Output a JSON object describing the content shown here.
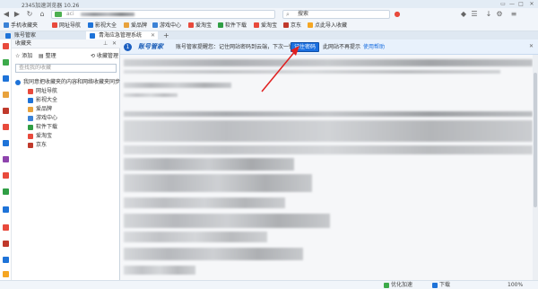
{
  "window": {
    "title": "2345加速浏览器 10.26",
    "controls": [
      "▭",
      "—",
      "□",
      "✕"
    ]
  },
  "nav": {
    "back": "◀",
    "forward": "▶",
    "refresh": "↻",
    "home": "⌂",
    "address_value": "aci",
    "search_placeholder": "搜索"
  },
  "bookmarks_bar": {
    "items": [
      {
        "label": "手机收藏夹",
        "color": "#3b82d6"
      },
      {
        "label": "网址导航",
        "color": "#e84a3c"
      },
      {
        "label": "影视大全",
        "color": "#1e73d8"
      },
      {
        "label": "爱品牌",
        "color": "#e8a23c"
      },
      {
        "label": "游戏中心",
        "color": "#3b82d6"
      },
      {
        "label": "爱淘宝",
        "color": "#e84a3c"
      },
      {
        "label": "软件下载",
        "color": "#2f9e44"
      },
      {
        "label": "爱淘宝",
        "color": "#e84a3c"
      },
      {
        "label": "京东",
        "color": "#c0392b"
      },
      {
        "label": "点此导入收藏",
        "color": "#f5a623"
      }
    ]
  },
  "tabs": [
    {
      "label": "账号管家",
      "active": false
    },
    {
      "label": "青海应急管理系统",
      "active": true
    }
  ],
  "new_tab": "+",
  "rail_icons": [
    {
      "name": "news-icon",
      "color": "#e84a3c"
    },
    {
      "name": "game-icon",
      "color": "#3caa4a"
    },
    {
      "name": "video-icon",
      "color": "#1e73d8"
    },
    {
      "name": "mail-icon",
      "color": "#e8a23c"
    },
    {
      "name": "shop-icon",
      "color": "#c0392b"
    },
    {
      "name": "weibo-icon",
      "color": "#e84a3c"
    },
    {
      "name": "music-icon",
      "color": "#1e73d8"
    },
    {
      "name": "tools-icon",
      "color": "#8e44ad"
    },
    {
      "name": "movie-icon",
      "color": "#e84a3c"
    },
    {
      "name": "book-icon",
      "color": "#2f9e44"
    },
    {
      "name": "dice-icon",
      "color": "#1e73d8"
    },
    {
      "name": "map-icon",
      "color": "#e84a3c"
    },
    {
      "name": "heart-icon",
      "color": "#c0392b"
    },
    {
      "name": "photo-icon",
      "color": "#1e73d8"
    },
    {
      "name": "game2-icon",
      "color": "#f5a623"
    },
    {
      "name": "chat-icon",
      "color": "#3caa4a"
    }
  ],
  "favorites": {
    "title": "收藏夹",
    "pin": "📌",
    "close": "✕",
    "add_label": "添加",
    "organize_label": "整理",
    "manage_label": "收藏管理",
    "search_placeholder": "查找我的收藏",
    "root_label": "我同意把收藏夹的内容和网络收藏夹同步",
    "items": [
      {
        "label": "网址导航",
        "color": "#e84a3c"
      },
      {
        "label": "影视大全",
        "color": "#1e73d8"
      },
      {
        "label": "爱品牌",
        "color": "#e8a23c"
      },
      {
        "label": "游戏中心",
        "color": "#3b82d6"
      },
      {
        "label": "软件下载",
        "color": "#2f9e44"
      },
      {
        "label": "爱淘宝",
        "color": "#e84a3c"
      },
      {
        "label": "京东",
        "color": "#c0392b"
      }
    ]
  },
  "notice": {
    "badge": "1",
    "brand": "账号管家",
    "message": "账号管家提醒您：记住网站密码到云端，下次一键登录。",
    "remember_label": "记住密码",
    "never_label": "此网站不再提示",
    "help_label": "使用帮助"
  },
  "status": {
    "speed_label": "优化加速",
    "download_label": "下载",
    "zoom_label": "100%"
  }
}
